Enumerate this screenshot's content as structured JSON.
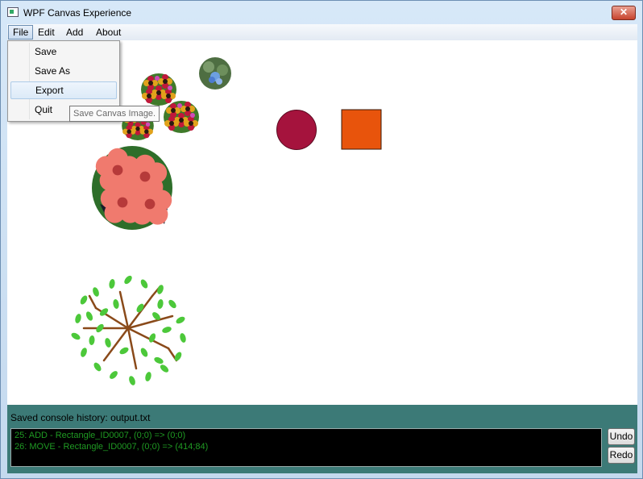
{
  "window": {
    "title": "WPF Canvas Experience",
    "close_label": "✕"
  },
  "menu": {
    "items": [
      {
        "label": "File"
      },
      {
        "label": "Edit"
      },
      {
        "label": "Add"
      },
      {
        "label": "About"
      }
    ],
    "file_dropdown": [
      {
        "label": "Save"
      },
      {
        "label": "Save As"
      },
      {
        "label": "Export"
      },
      {
        "label": "Quit"
      }
    ],
    "tooltip": "Save Canvas Image."
  },
  "canvas": {
    "shapes": [
      {
        "type": "ellipse",
        "color": "#a5133d"
      },
      {
        "type": "rectangle",
        "color": "#e8540c"
      }
    ],
    "images": [
      "flower-cluster-small",
      "blue-flower-bush",
      "flower-cluster-small",
      "flower-cluster-small",
      "pink-flower-bush",
      "tree-top-view"
    ]
  },
  "console": {
    "status": "Saved console history: output.txt",
    "lines": [
      "25: ADD - Rectangle_ID0007, (0;0) => (0;0)",
      "26: MOVE - Rectangle_ID0007, (0;0) => (414;84)"
    ],
    "text_color": "#1f9a23",
    "undo_label": "Undo",
    "redo_label": "Redo"
  }
}
